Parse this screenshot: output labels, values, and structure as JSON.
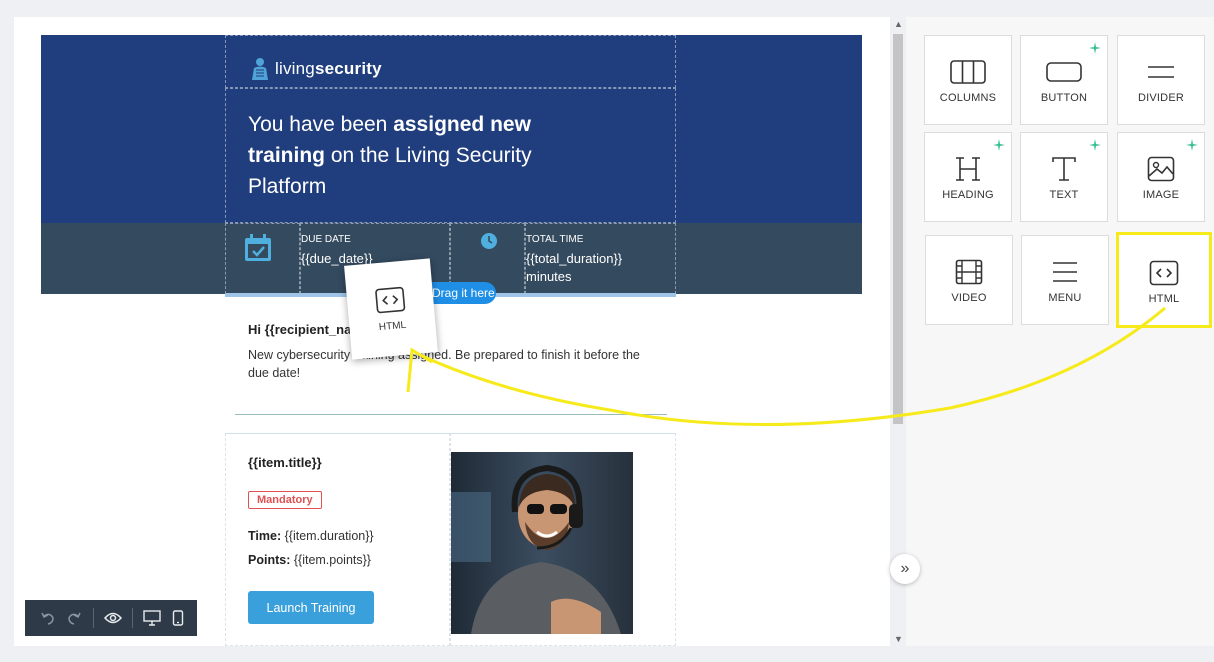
{
  "email": {
    "logo": {
      "prefix": "living",
      "suffix": "security"
    },
    "headline": {
      "part1": "You have been ",
      "bold1": "assigned new training",
      "part2": " on the Living Security Platform"
    },
    "due_date": {
      "label": "DUE DATE",
      "value": "{{due_date}}"
    },
    "total_time": {
      "label": "TOTAL TIME",
      "value_line1": "{{total_duration}}",
      "value_line2": "minutes"
    },
    "drop_hint": "Drag it here",
    "greeting": "Hi {{recipient_name}},",
    "body_text": "New cybersecurity training assigned. Be prepared to finish it before the due date!",
    "item": {
      "title": "{{item.title}}",
      "badge": "Mandatory",
      "time_label": "Time:",
      "time_value": "{{item.duration}}",
      "points_label": "Points:",
      "points_value": "{{item.points}}",
      "cta": "Launch Training"
    }
  },
  "drag_ghost": {
    "label": "HTML"
  },
  "panel": {
    "tiles": [
      {
        "label": "COLUMNS",
        "icon": "columns-icon",
        "ai": false
      },
      {
        "label": "BUTTON",
        "icon": "button-icon",
        "ai": true
      },
      {
        "label": "DIVIDER",
        "icon": "divider-icon",
        "ai": false
      },
      {
        "label": "HEADING",
        "icon": "heading-icon",
        "ai": true
      },
      {
        "label": "TEXT",
        "icon": "text-icon",
        "ai": true
      },
      {
        "label": "IMAGE",
        "icon": "image-icon",
        "ai": true
      },
      {
        "label": "VIDEO",
        "icon": "video-icon",
        "ai": false
      },
      {
        "label": "MENU",
        "icon": "menu-icon",
        "ai": false
      },
      {
        "label": "HTML",
        "icon": "html-icon",
        "ai": false,
        "highlighted": true
      }
    ]
  },
  "toolbar": {
    "buttons": [
      "undo-icon",
      "redo-icon",
      "preview-eye-icon",
      "desktop-view-icon",
      "mobile-view-icon"
    ]
  },
  "colors": {
    "header_bg": "#203e7d",
    "info_band_bg": "#344a5f",
    "accent_blue": "#3aa0dc",
    "badge_red": "#e05252",
    "highlight_yellow": "#f7ea1a",
    "ai_sparkle_green": "#3bbf8f"
  }
}
